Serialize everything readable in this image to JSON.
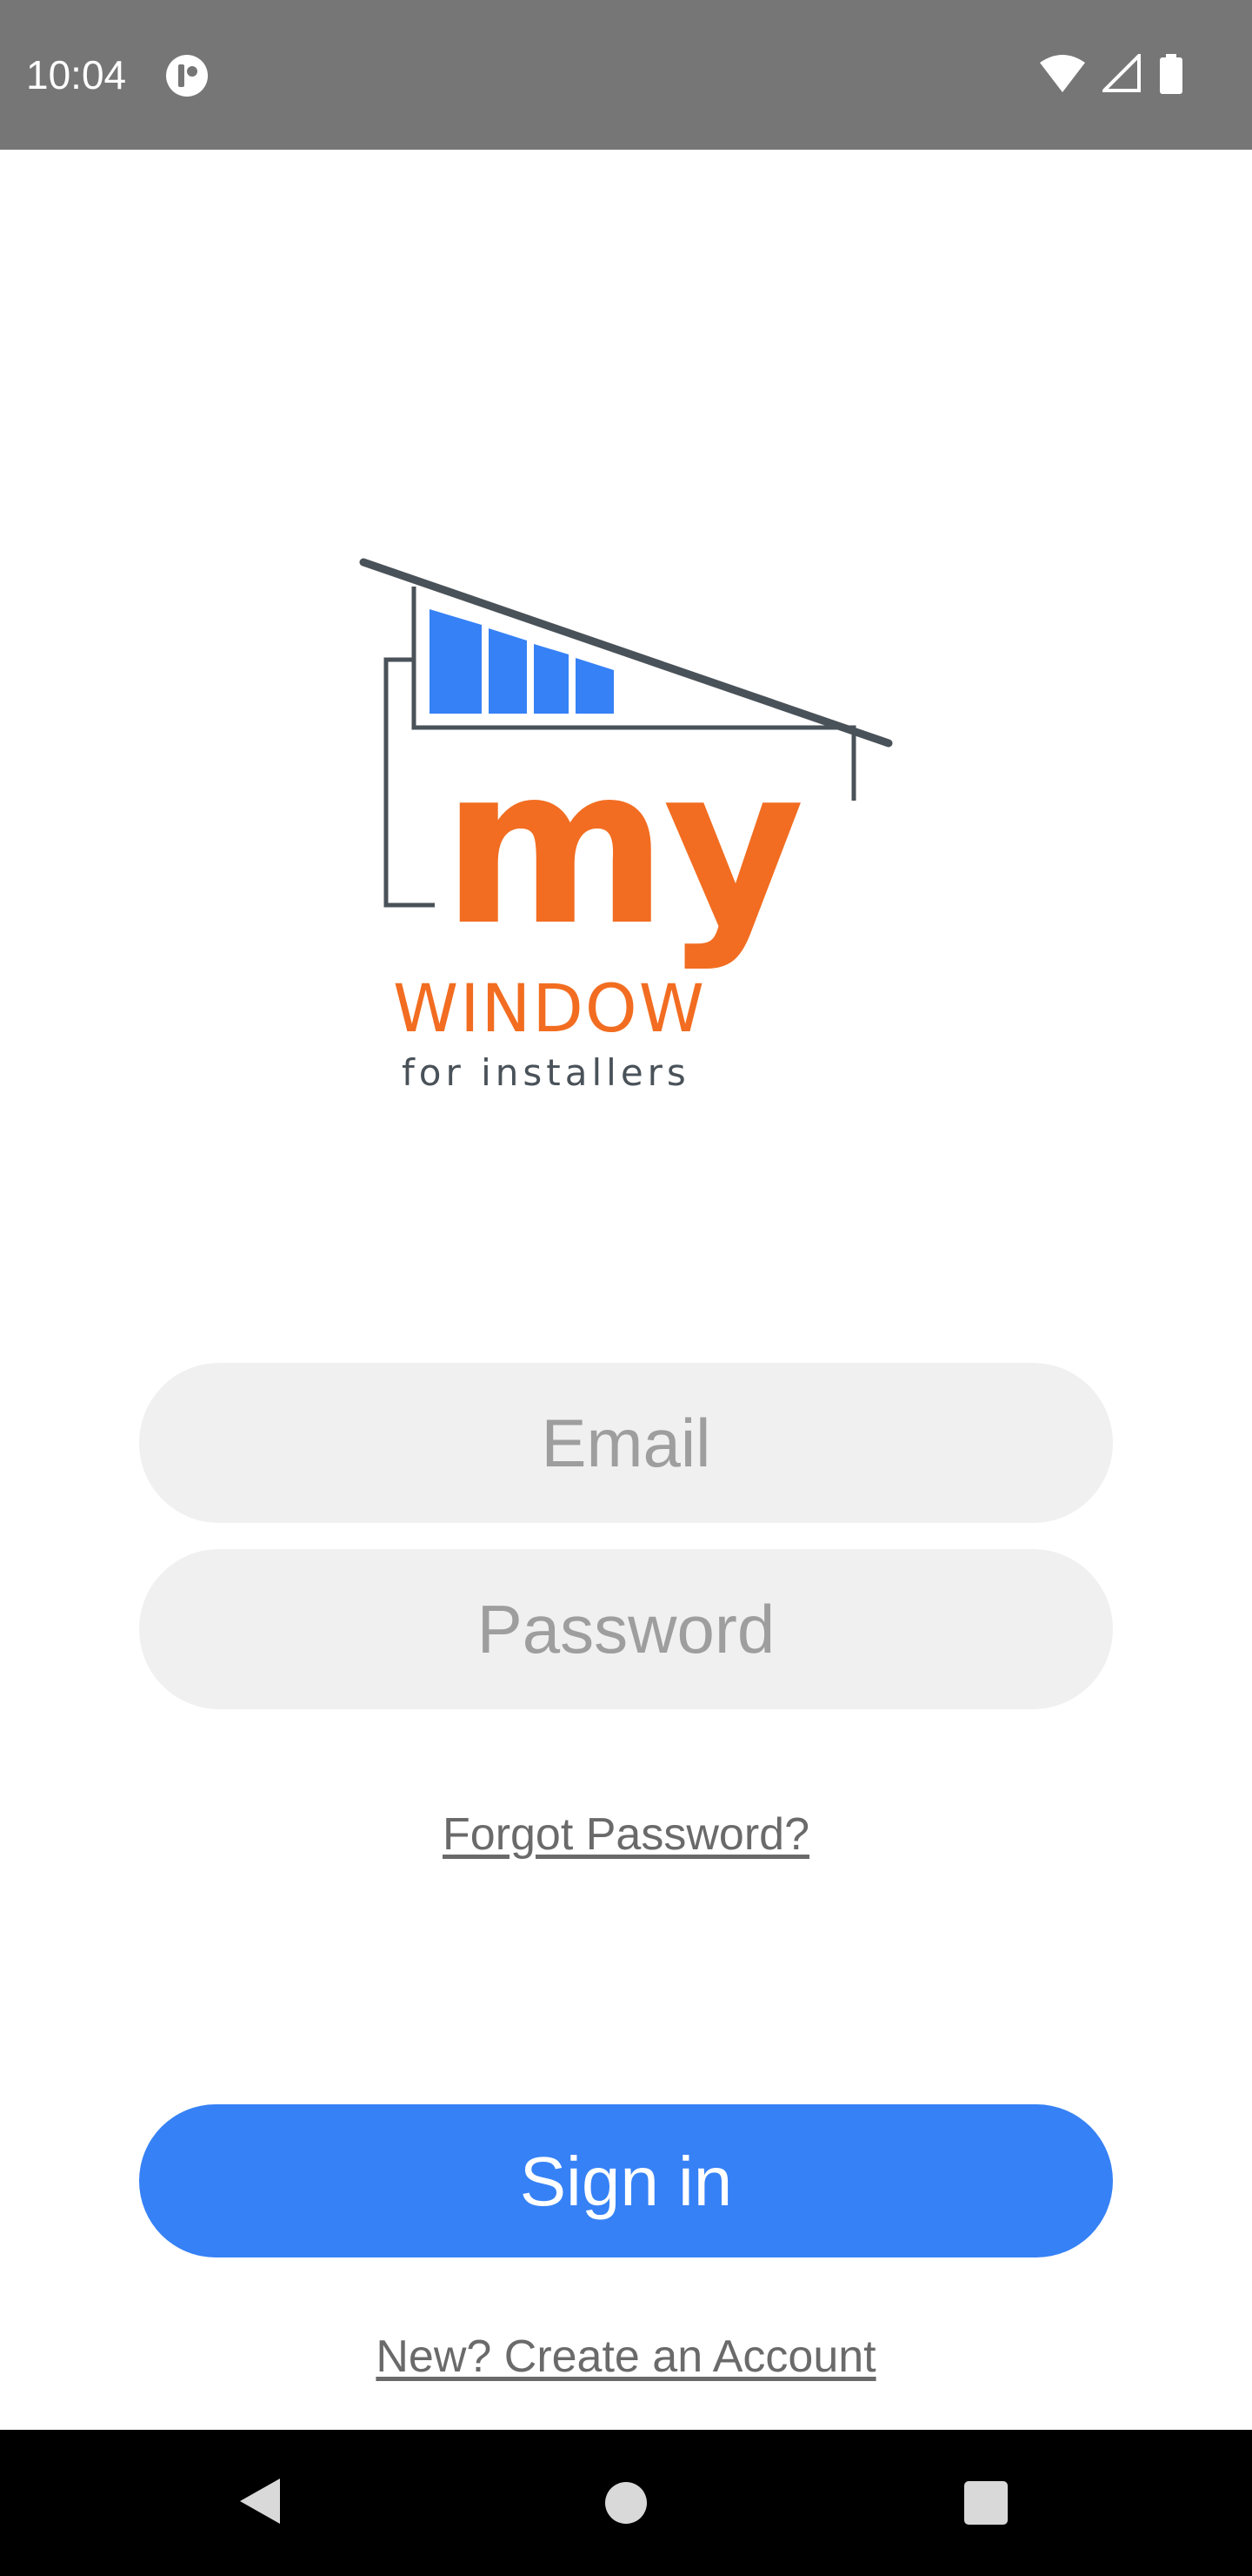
{
  "status_bar": {
    "time": "10:04",
    "background": "#767676",
    "icons": [
      "app-notification-icon",
      "wifi-icon",
      "cell-signal-icon",
      "battery-icon"
    ]
  },
  "logo": {
    "my": "my",
    "brand": "WINDOW",
    "tagline": "for installers",
    "accent_color": "#f26d21",
    "bars_color": "#3681f6",
    "outline_color": "#4a5259"
  },
  "form": {
    "email_placeholder": "Email",
    "email_value": "",
    "password_placeholder": "Password",
    "password_value": "",
    "forgot_label": "Forgot Password?",
    "signin_label": "Sign in",
    "create_account_label": "New? Create an Account"
  },
  "colors": {
    "primary": "#3681f6",
    "input_bg": "#f0f0f0",
    "placeholder": "#9e9e9e",
    "link": "#6a6a6a"
  },
  "nav_bar": {
    "icons": [
      "back-icon",
      "home-icon",
      "recents-icon"
    ]
  }
}
